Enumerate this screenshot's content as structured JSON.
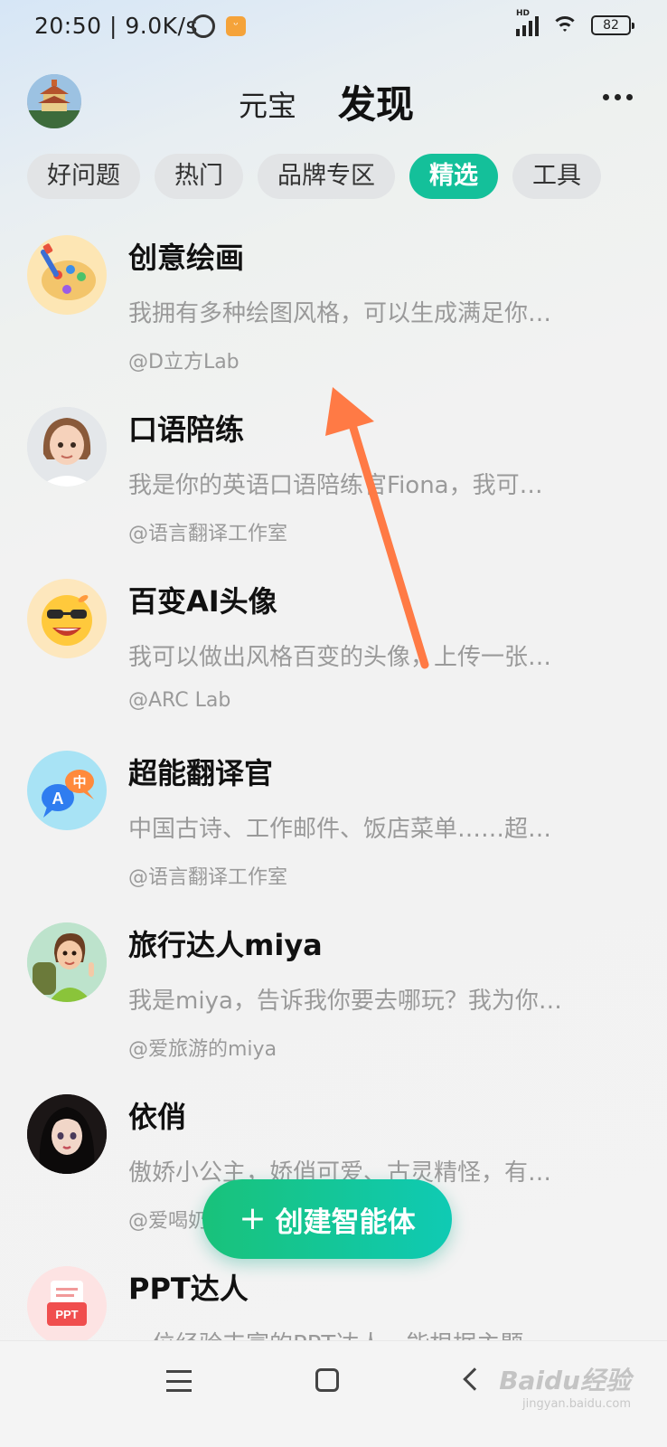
{
  "status_bar": {
    "time": "20:50",
    "speed": "| 9.0K/s",
    "battery": "82",
    "app_badge_glyph": "ᵕ",
    "hd_label": "HD"
  },
  "header": {
    "left_label": "元宝",
    "title": "发现"
  },
  "tabs": [
    {
      "label": "好问题",
      "active": false
    },
    {
      "label": "热门",
      "active": false
    },
    {
      "label": "品牌专区",
      "active": false
    },
    {
      "label": "精选",
      "active": true
    },
    {
      "label": "工具",
      "active": false
    }
  ],
  "items": [
    {
      "title": "创意绘画",
      "desc": "我拥有多种绘图风格，可以生成满足你…",
      "author": "@D立方Lab",
      "icon": "palette-icon"
    },
    {
      "title": "口语陪练",
      "desc": "我是你的英语口语陪练官Fiona，我可…",
      "author": "@语言翻译工作室",
      "icon": "girl-avatar-icon"
    },
    {
      "title": "百变AI头像",
      "desc": "我可以做出风格百变的头像，上传一张…",
      "author": "@ARC Lab",
      "icon": "sunglasses-emoji-icon"
    },
    {
      "title": "超能翻译官",
      "desc": "中国古诗、工作邮件、饭店菜单……超…",
      "author": "@语言翻译工作室",
      "icon": "translate-bubbles-icon"
    },
    {
      "title": "旅行达人miya",
      "desc": "我是miya，告诉我你要去哪玩？我为你…",
      "author": "@爱旅游的miya",
      "icon": "traveler-avatar-icon"
    },
    {
      "title": "依俏",
      "desc": "傲娇小公主，娇俏可爱、古灵精怪，有…",
      "author": "@爱喝奶",
      "icon": "princess-avatar-icon"
    },
    {
      "title": "PPT达人",
      "desc": "一位经验丰富的PPT达人，能根据主题",
      "author": "",
      "icon": "ppt-icon"
    }
  ],
  "translate_icon_text": {
    "a": "A",
    "zh": "中"
  },
  "ppt_icon_text": "PPT",
  "fab": {
    "label": "创建智能体"
  },
  "watermark": {
    "main": "Baidu经验",
    "sub": "jingyan.baidu.com"
  },
  "colors": {
    "accent": "#14c09a",
    "arrow": "#ff7a45"
  }
}
